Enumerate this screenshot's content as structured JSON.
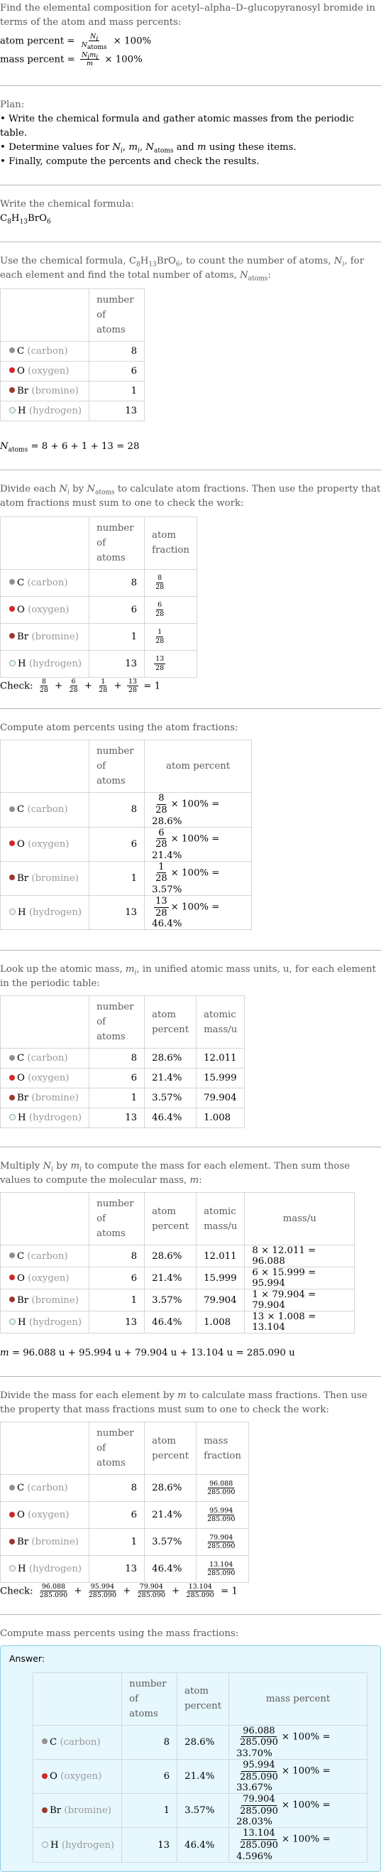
{
  "intro": {
    "question": "Find the elemental composition for acetyl–alpha–D–glucopyranosyl bromide in terms of the atom and mass percents:",
    "atom_percent_label": "atom percent =",
    "mass_percent_label": "mass percent =",
    "times_100": "× 100%"
  },
  "plan": {
    "title": "Plan:",
    "items": [
      "Write the chemical formula and gather atomic masses from the periodic table.",
      "Determine values for Nᵢ, mᵢ, N_atoms and m using these items.",
      "Finally, compute the percents and check the results."
    ]
  },
  "formula_step": {
    "title": "Write the chemical formula:",
    "formula": "C8H13BrO6"
  },
  "elements": [
    {
      "symbol": "C",
      "name": "(carbon)",
      "color": "#909090",
      "hollow": false,
      "count": "8",
      "atom_fraction_num": "8",
      "atom_fraction_den": "28",
      "atom_percent": "28.6%",
      "atomic_mass": "12.011",
      "mass": "96.088",
      "mass_product": "8 × 12.011 = 96.088",
      "mass_percent": "33.70%"
    },
    {
      "symbol": "O",
      "name": "(oxygen)",
      "color": "#d0282c",
      "hollow": false,
      "count": "6",
      "atom_fraction_num": "6",
      "atom_fraction_den": "28",
      "atom_percent": "21.4%",
      "atomic_mass": "15.999",
      "mass": "95.994",
      "mass_product": "6 × 15.999 = 95.994",
      "mass_percent": "33.67%"
    },
    {
      "symbol": "Br",
      "name": "(bromine)",
      "color": "#9a3a2c",
      "hollow": false,
      "count": "1",
      "atom_fraction_num": "1",
      "atom_fraction_den": "28",
      "atom_percent": "3.57%",
      "atomic_mass": "79.904",
      "mass": "79.904",
      "mass_product": "1 × 79.904 = 79.904",
      "mass_percent": "28.03%"
    },
    {
      "symbol": "H",
      "name": "(hydrogen)",
      "color": "#e8f8fa",
      "hollow": true,
      "count": "13",
      "atom_fraction_num": "13",
      "atom_fraction_den": "28",
      "atom_percent": "46.4%",
      "atomic_mass": "1.008",
      "mass": "13.104",
      "mass_product": "13 × 1.008 = 13.104",
      "mass_percent": "4.596%"
    }
  ],
  "headers": {
    "number_of_atoms": "number of atoms",
    "atom_fraction": "atom fraction",
    "atom_percent": "atom percent",
    "atomic_mass": "atomic mass/u",
    "mass": "mass/u",
    "mass_fraction": "mass fraction",
    "mass_percent": "mass percent"
  },
  "count_step": {
    "text_a": "Use the chemical formula, ",
    "text_b": ", to count the number of atoms, ",
    "text_c": ", for each element and find the total number of atoms, ",
    "text_d": ":",
    "total": "= 8 + 6 + 1 + 13 = 28"
  },
  "fraction_step": {
    "text_a": "Divide each ",
    "text_b": " by ",
    "text_c": " to calculate atom fractions. Then use the property that atom fractions must sum to one to check the work:",
    "check_label": "Check:",
    "check_result": "= 1"
  },
  "atom_percent_step": {
    "text": "Compute atom percents using the atom fractions:",
    "suffix": "× 100% ="
  },
  "mass_lookup_step": {
    "text_a": "Look up the atomic mass, ",
    "text_b": ", in unified atomic mass units, u, for each element in the periodic table:"
  },
  "molecular_mass_step": {
    "text_a": "Multiply ",
    "text_b": " by ",
    "text_c": " to compute the mass for each element. Then sum those values to compute the molecular mass, ",
    "text_d": ":",
    "sum": "= 96.088 u + 95.994 u + 79.904 u + 13.104 u = 285.090 u",
    "total_mass": "285.090"
  },
  "mass_fraction_step": {
    "text_a": "Divide the mass for each element by ",
    "text_b": " to calculate mass fractions. Then use the property that mass fractions must sum to one to check the work:",
    "check_label": "Check:",
    "check_result": "= 1"
  },
  "mass_percent_step": {
    "text": "Compute mass percents using the mass fractions:",
    "answer_label": "Answer:",
    "suffix": "× 100% ="
  }
}
